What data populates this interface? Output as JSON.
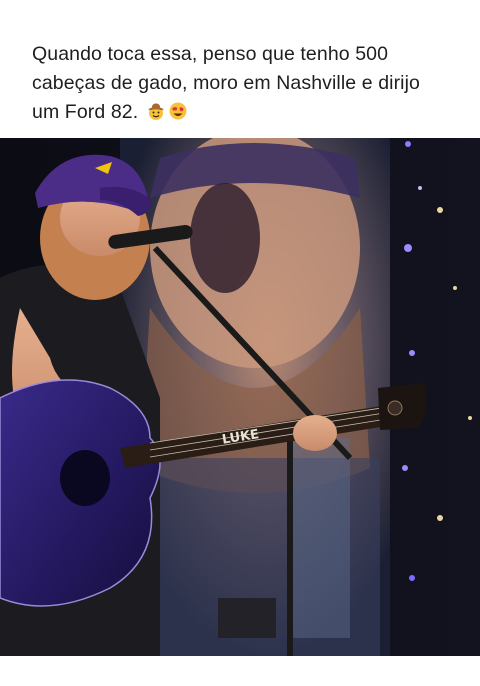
{
  "post": {
    "caption": "Quando toca essa, penso que tenho 500 cabeças de gado, moro em Nashville e dirijo um Ford 82.",
    "caption_line1": "Quando toca essa, penso que tenho 500",
    "caption_line2": "cabeças de gado, moro em Nashville e dirijo",
    "caption_line3": "um Ford 82.",
    "emojis": [
      "cowboy-hat-face",
      "heart-eyes-face"
    ]
  },
  "media": {
    "type": "concert-photo",
    "guitar_inlay": "LUKE"
  },
  "colors": {
    "background": "#ffffff",
    "text": "#1f1f1f",
    "hat": "#4b2c87",
    "guitar": "#2d1f6b"
  }
}
